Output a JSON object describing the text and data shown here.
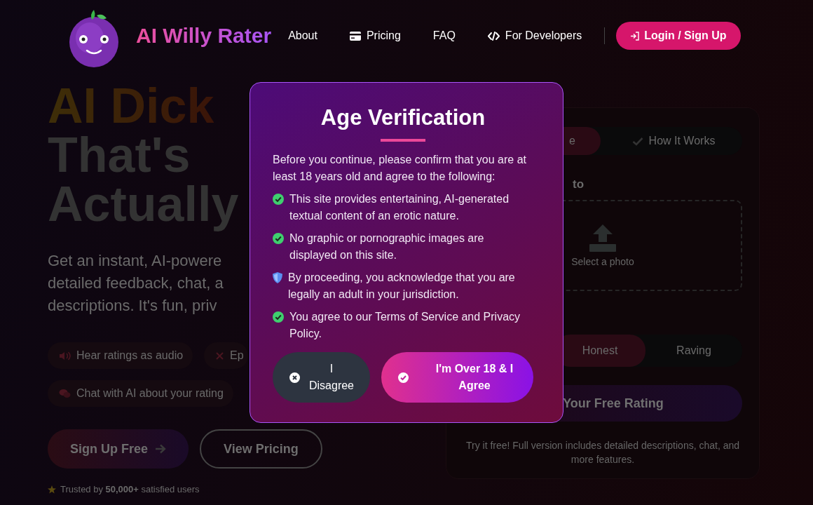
{
  "header": {
    "brand": "AI Willy Rater",
    "nav": [
      "About",
      "Pricing",
      "FAQ",
      "For Developers"
    ],
    "login": "Login / Sign Up"
  },
  "hero": {
    "title_lines": [
      "AI Dick",
      "That's",
      "Actually"
    ],
    "intro_lines": [
      "Get an instant, AI-powere",
      "detailed feedback, chat, a",
      "descriptions. It's fun, priv"
    ],
    "features": [
      "Hear ratings as audio",
      "Ep",
      "Chat with AI about your rating"
    ],
    "primary_button": "Sign Up Free",
    "secondary_button": "View Pricing",
    "trust": "Trusted by **50,000+** satisfied users"
  },
  "rater": {
    "tabs": [
      {
        "label": "e",
        "selected": true
      },
      {
        "label": "How It Works",
        "selected": false
      }
    ],
    "upload_label": "to",
    "upload_hint": "Select a photo",
    "tones": [
      {
        "label": "Honest",
        "selected": true
      },
      {
        "label": "Raving",
        "selected": false
      }
    ],
    "submit": "Your Free Rating",
    "note": "Try it free! Full version includes detailed descriptions, chat, and more features."
  },
  "modal": {
    "title": "Age Verification",
    "intro": "Before you continue, please confirm that you are at least 18 years old and agree to the following:",
    "terms": [
      {
        "kind": "check",
        "text": "This site provides entertaining, AI-generated textual content of an erotic nature."
      },
      {
        "kind": "check",
        "text": "No graphic or pornographic images are displayed on this site."
      },
      {
        "kind": "shield",
        "text": "By proceeding, you acknowledge that you are legally an adult in your jurisdiction."
      },
      {
        "kind": "check",
        "text": "You agree to our Terms of Service and Privacy Policy."
      }
    ],
    "disagree": "I Disagree",
    "agree": "I'm Over 18 & I Agree"
  }
}
